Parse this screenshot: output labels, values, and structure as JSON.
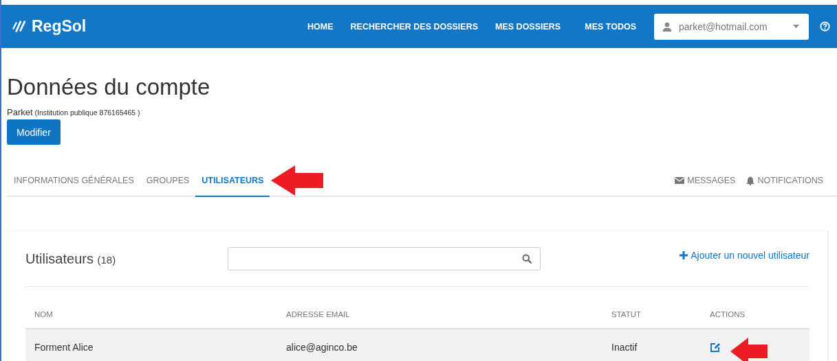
{
  "header": {
    "logo": "RegSol",
    "nav": [
      {
        "label": "HOME"
      },
      {
        "label": "RECHERCHER DES DOSSIERS"
      },
      {
        "label": "MES DOSSIERS"
      },
      {
        "label": "MES TODOS"
      }
    ],
    "user_menu": {
      "label": "parket@hotmail.com"
    }
  },
  "page": {
    "title": "Données du compte",
    "account_name": "Parket",
    "account_detail": "(Institution publique 876165465 )",
    "edit_button": "Modifier"
  },
  "tabs": [
    {
      "label": "INFORMATIONS GÉNÉRALES",
      "selected": false
    },
    {
      "label": "GROUPES",
      "selected": false
    },
    {
      "label": "UTILISATEURS",
      "selected": true
    }
  ],
  "side_links": [
    {
      "kind": "mail",
      "label": "MESSAGES"
    },
    {
      "kind": "bell",
      "label": "NOTIFICATIONS"
    }
  ],
  "users": {
    "title": "Utilisateurs",
    "count": "(18)",
    "add_link": "Ajouter un nouvel utilisateur",
    "columns": [
      "NOM",
      "ADRESSE EMAIL",
      "STATUT",
      "ACTIONS"
    ],
    "rows": [
      {
        "name": "Forment Alice",
        "email": "alice@aginco.be",
        "status": "Inactif"
      }
    ]
  }
}
